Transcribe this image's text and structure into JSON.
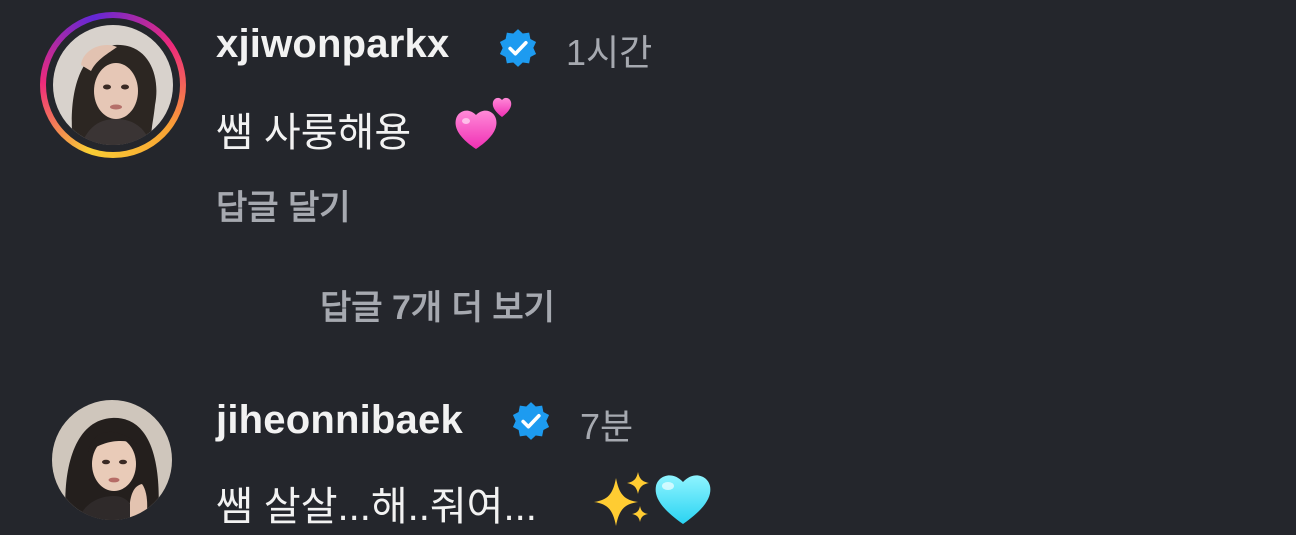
{
  "comments": [
    {
      "username": "xjiwonparkx",
      "verified": true,
      "time": "1시간",
      "text": "쌤 사룽해용",
      "emoji": [
        "two-hearts-icon"
      ],
      "reply_label": "답글 달기",
      "has_story_ring": true
    },
    {
      "username": "jiheonnibaek",
      "verified": true,
      "time": "7분",
      "text": "쌤 살살...해..줘여...",
      "emoji": [
        "sparkles-icon",
        "light-blue-heart-icon"
      ],
      "has_story_ring": false
    }
  ],
  "more_replies_label": "답글 7개 더 보기",
  "colors": {
    "background": "#24262c",
    "primary_text": "#f2f2f2",
    "secondary_text": "#a6a9b0",
    "verified_badge": "#1d9bf0"
  }
}
